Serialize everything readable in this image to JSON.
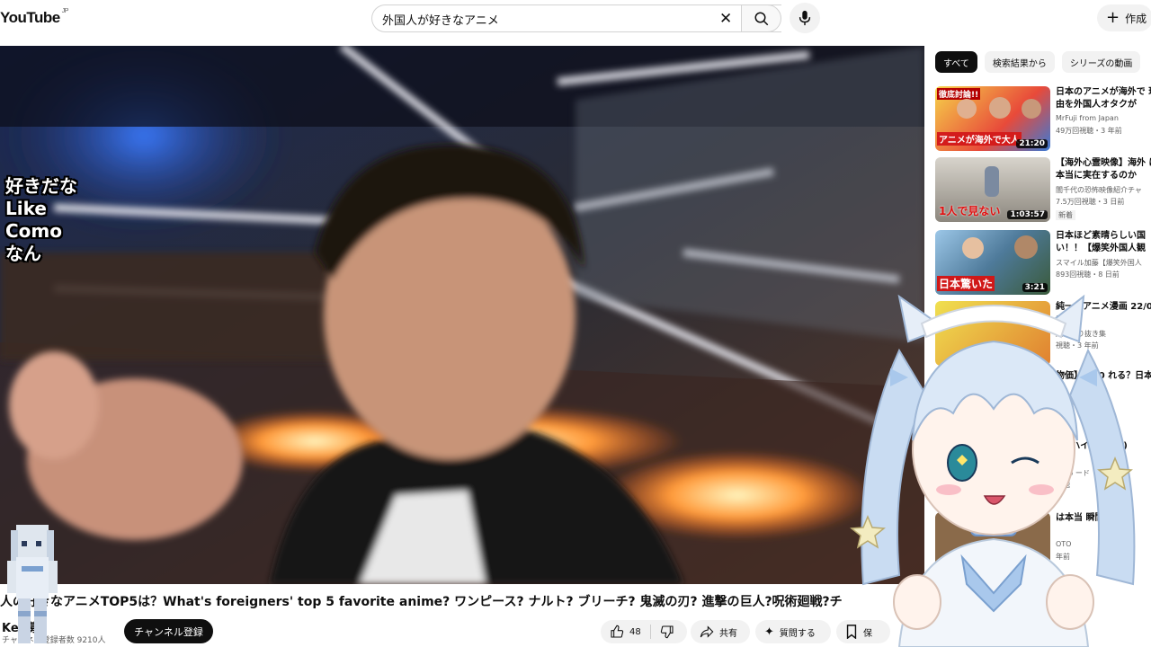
{
  "header": {
    "logo": "YouTube",
    "logo_region": "JP",
    "search_value": "外国人が好きなアニメ",
    "create_label": "作成"
  },
  "video": {
    "caption_lines": [
      "好きだな",
      "Like",
      "Como",
      "なん"
    ],
    "title": "人の好きなアニメTOP5は？What's foreigners' top 5 favorite anime? ワンピース? ナルト? ブリーチ? 鬼滅の刃? 進撃の巨人?呪術廻戦?チ",
    "channel_name": "Kei   募",
    "channel_subs": "チャンネル登録者数 9210人",
    "subscribe_label": "チャンネル登録",
    "like_count": "48",
    "share_label": "共有",
    "ask_label": "質問する",
    "save_label": "保"
  },
  "chips": [
    "すべて",
    "検索結果から",
    "シリーズの動画"
  ],
  "recommendations": [
    {
      "title": "日本のアニメが海外で 理由を外国人オタクが",
      "channel": "MrFuji from Japan",
      "meta": "49万回視聴・3 年前",
      "duration": "21:20",
      "badge": ""
    },
    {
      "title": "【海外心霊映像】海外 は本当に実在するのか",
      "channel": "闇千代の恐怖映像紹介チャ",
      "meta": "7.5万回視聴・3 日前",
      "duration": "1:03:57",
      "badge": "新着"
    },
    {
      "title": "日本ほど素晴らしい国 い！！【爆笑外国人観",
      "channel": "スマイル加藤【爆笑外国人",
      "meta": "893回視聴・8 日前",
      "duration": "3:21",
      "badge": ""
    },
    {
      "title": "純一のアニメ漫画 22/04/10]",
      "channel": "純一切り抜き集",
      "meta": "視聴・3 年前",
      "duration": "",
      "badge": ""
    },
    {
      "title": "物価】50,0 れる？日本",
      "channel": "ベトナム",
      "meta": "日前",
      "duration": "",
      "badge": ""
    },
    {
      "title": "03 ハイラ (エゴ)",
      "channel": "VTub ード",
      "meta": "視聴",
      "duration": "",
      "badge": ""
    },
    {
      "title": "は本当 瞬間です",
      "channel": "OTO",
      "meta": "年前",
      "duration": "",
      "badge": ""
    }
  ],
  "thumb_texts": {
    "r1_top": "徹底討論!!",
    "r1_bottom": "アニメが海外で大人",
    "r2_bottom": "1人で見ない",
    "r3_bottom": "日本驚いた"
  },
  "colors": {
    "accent_red": "#ff0000",
    "chip_active": "#0f0f0f",
    "subscribe_bg": "#0f0f0f"
  }
}
